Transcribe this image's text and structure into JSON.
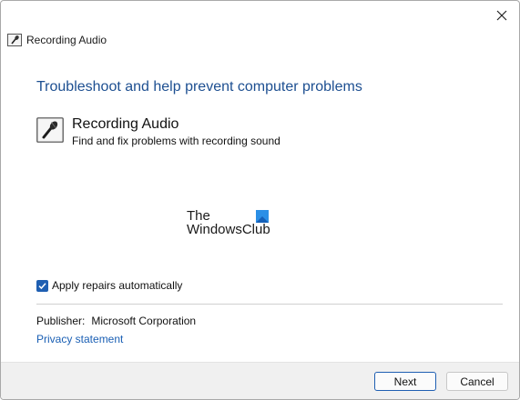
{
  "window": {
    "title": "Recording Audio"
  },
  "main": {
    "heading": "Troubleshoot and help prevent computer problems",
    "tool": {
      "name": "Recording Audio",
      "description": "Find and fix problems with recording sound",
      "icon": "microphone-icon"
    },
    "watermark": {
      "line1": "The",
      "line2": "WindowsClub"
    },
    "apply_repairs": {
      "label": "Apply repairs automatically",
      "checked": true
    },
    "publisher": {
      "label": "Publisher:",
      "value": "Microsoft Corporation"
    },
    "privacy_link": "Privacy statement"
  },
  "footer": {
    "next_label": "Next",
    "cancel_label": "Cancel"
  },
  "colors": {
    "heading": "#1d4f91",
    "accent": "#1f5fb2",
    "link": "#1a5fb4",
    "footer_bg": "#f0f0f0"
  }
}
